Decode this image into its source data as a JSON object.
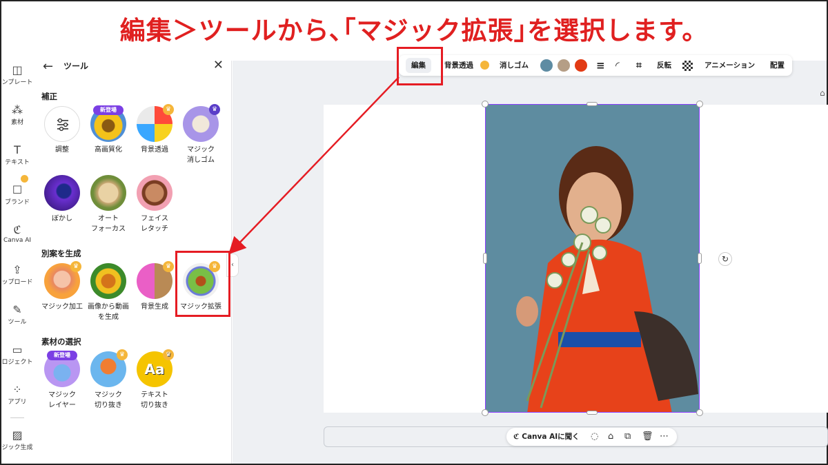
{
  "headline": "編集＞ツールから､｢マジック拡張｣を選択します。",
  "rail": [
    {
      "label": "ンプレート",
      "icon": "template-icon"
    },
    {
      "label": "素材",
      "icon": "elements-icon"
    },
    {
      "label": "テキスト",
      "icon": "text-icon"
    },
    {
      "label": "ブランド",
      "icon": "brand-icon"
    },
    {
      "label": "Canva AI",
      "icon": "canva-ai-icon"
    },
    {
      "label": "ップロード",
      "icon": "upload-icon"
    },
    {
      "label": "ツール",
      "icon": "tools-icon"
    },
    {
      "label": "ロジェクト",
      "icon": "folder-icon"
    },
    {
      "label": "アプリ",
      "icon": "apps-icon"
    },
    {
      "label": "ジック生成",
      "icon": "magic-generate-icon"
    }
  ],
  "panel": {
    "title": "ツール",
    "sections": {
      "correction": "補正",
      "generate": "別案を生成",
      "select": "素材の選択"
    },
    "tools": {
      "adjust": "調整",
      "upscale": "高画質化",
      "bg_remove": "背景透過",
      "magic_eraser": "マジック\n消しゴム",
      "blur": "ぼかし",
      "autofocus": "オート\nフォーカス",
      "face_retouch": "フェイス\nレタッチ",
      "magic_edit": "マジック加工",
      "img_to_video": "画像から動画\nを生成",
      "bg_generate": "背景生成",
      "magic_expand": "マジック拡張",
      "magic_layer": "マジック\nレイヤー",
      "magic_grab": "マジック\n切り抜き",
      "text_grab": "テキスト\n切り抜き"
    },
    "badge_new": "新登場",
    "text_grab_glyph": "Aa"
  },
  "toolbar": {
    "edit": "編集",
    "bg_remove": "背景透過",
    "eraser": "消しゴム",
    "flip": "反転",
    "animation": "アニメーション",
    "position": "配置",
    "swatch_colors": [
      "#5e8ca3",
      "#b59e86",
      "#e23a14"
    ]
  },
  "ai_bar": {
    "label": "Canva AIに聞く"
  },
  "colors": {
    "highlight": "#e51c23",
    "selection": "#8b3dff",
    "premium_crown": "#f5b63a"
  }
}
